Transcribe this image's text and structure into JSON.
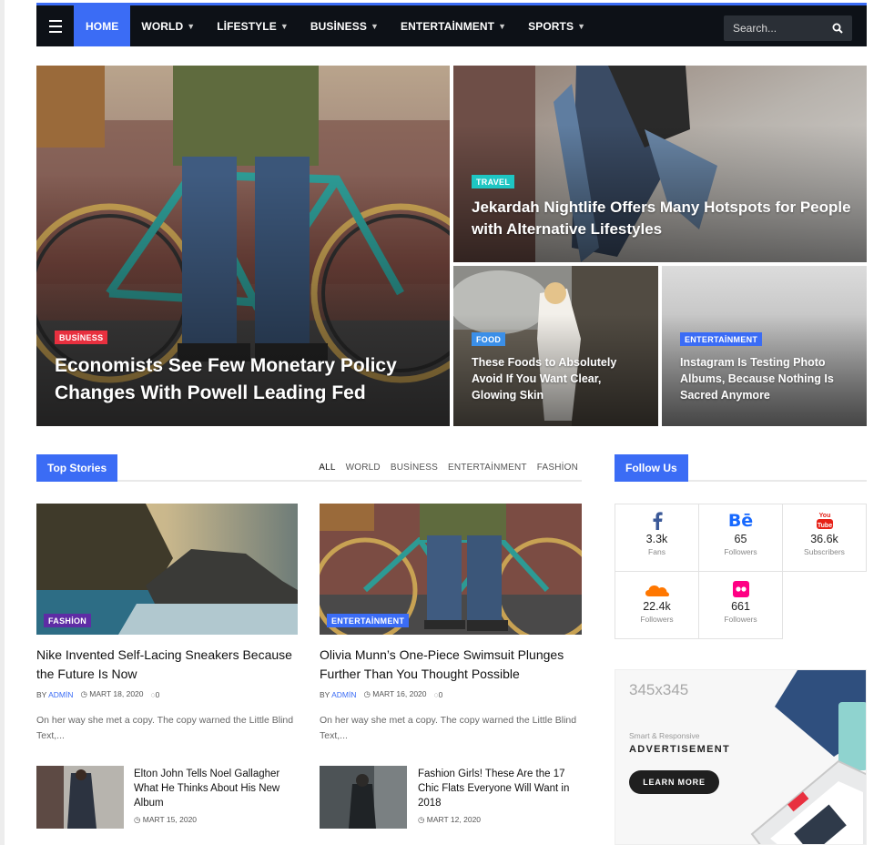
{
  "nav": {
    "items": [
      {
        "label": "HOME",
        "active": true,
        "dropdown": false
      },
      {
        "label": "WORLD",
        "dropdown": true
      },
      {
        "label": "LİFESTYLE",
        "dropdown": true
      },
      {
        "label": "BUSİNESS",
        "dropdown": true
      },
      {
        "label": "ENTERTAİNMENT",
        "dropdown": true
      },
      {
        "label": "SPORTS",
        "dropdown": true
      }
    ],
    "search_placeholder": "Search...",
    "icons": [
      "menu-icon",
      "search-icon"
    ]
  },
  "hero": {
    "main": {
      "category": "BUSİNESS",
      "title": "Economists See Few Monetary Policy Changes With Powell Leading Fed"
    },
    "top_right": {
      "category": "TRAVEL",
      "title": "Jekardah Nightlife Offers Many Hotspots for People with Alternative Lifestyles"
    },
    "bottom_left": {
      "category": "FOOD",
      "title": "These Foods to Absolutely Avoid If You Want Clear, Glowing Skin"
    },
    "bottom_right": {
      "category": "ENTERTAİNMENT",
      "title": "Instagram Is Testing Photo Albums, Because Nothing Is Sacred Anymore"
    }
  },
  "top_stories": {
    "heading": "Top Stories",
    "filters": [
      "ALL",
      "WORLD",
      "BUSİNESS",
      "ENTERTAİNMENT",
      "FASHİON"
    ],
    "featured": [
      {
        "category": "FASHİON",
        "title": "Nike Invented Self-Lacing Sneakers Because the Future Is Now",
        "by": "BY",
        "author": "ADMİN",
        "date": "MART 18, 2020",
        "comments": "0",
        "excerpt": "On her way she met a copy. The copy warned the Little Blind Text,..."
      },
      {
        "category": "ENTERTAİNMENT",
        "title": "Olivia Munn’s One-Piece Swimsuit Plunges Further Than You Thought Possible",
        "by": "BY",
        "author": "ADMİN",
        "date": "MART 16, 2020",
        "comments": "0",
        "excerpt": "On her way she met a copy. The copy warned the Little Blind Text,..."
      }
    ],
    "small": [
      {
        "title": "Elton John Tells Noel Gallagher What He Thinks About His New Album",
        "date": "MART 15, 2020"
      },
      {
        "title": "Fashion Girls! These Are the 17 Chic Flats Everyone Will Want in 2018",
        "date": "MART 12, 2020"
      }
    ]
  },
  "follow": {
    "heading": "Follow Us",
    "networks": [
      {
        "icon": "facebook-icon",
        "count": "3.3k",
        "label": "Fans",
        "color": "#3b5998"
      },
      {
        "icon": "behance-icon",
        "count": "65",
        "label": "Followers",
        "color": "#1769ff"
      },
      {
        "icon": "youtube-icon",
        "count": "36.6k",
        "label": "Subscribers",
        "color": "#e62117"
      },
      {
        "icon": "soundcloud-icon",
        "count": "22.4k",
        "label": "Followers",
        "color": "#ff7700"
      },
      {
        "icon": "flickr-icon",
        "count": "661",
        "label": "Followers",
        "color": "#ff0084"
      }
    ]
  },
  "ad": {
    "size": "345x345",
    "tagline": "Smart & Responsive",
    "headline": "ADVERTISEMENT",
    "button": "LEARN MORE"
  },
  "colors": {
    "accent": "#3b6cf5",
    "nav_bg": "#0d1117",
    "business": "#e8303f",
    "travel": "#1ec6c3",
    "food": "#3b8fe8",
    "entertainment": "#3b6cf5",
    "fashion": "#5e2ca5"
  }
}
